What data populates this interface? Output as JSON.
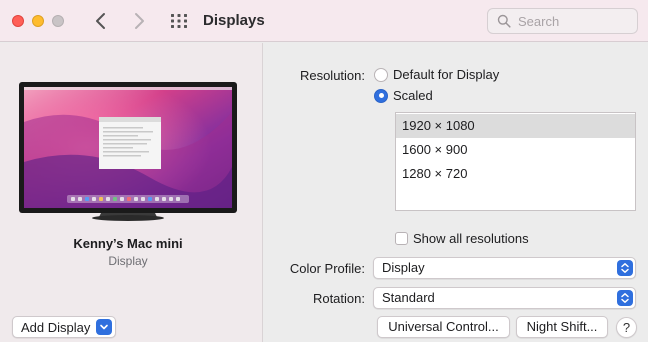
{
  "toolbar": {
    "title": "Displays",
    "search": {
      "placeholder": "Search",
      "value": ""
    }
  },
  "left": {
    "display_name": "Kenny’s Mac mini",
    "display_type": "Display",
    "add_display_label": "Add Display"
  },
  "right": {
    "resolution_label": "Resolution:",
    "resolution_options": [
      "Default for Display",
      "Scaled"
    ],
    "resolution_selected": "Scaled",
    "resolutions": [
      "1920 × 1080",
      "1600 × 900",
      "1280 × 720"
    ],
    "selected_resolution": "1920 × 1080",
    "show_all_label": "Show all resolutions",
    "show_all_checked": false,
    "color_profile_label": "Color Profile:",
    "color_profile_value": "Display",
    "rotation_label": "Rotation:",
    "rotation_value": "Standard",
    "universal_control_label": "Universal Control...",
    "night_shift_label": "Night Shift...",
    "help_label": "?"
  },
  "colors": {
    "accent": "#2f6fde",
    "toolbar_bg": "#f6e9ee",
    "traffic_red": "#ff5f57",
    "traffic_yellow": "#febc2e"
  }
}
